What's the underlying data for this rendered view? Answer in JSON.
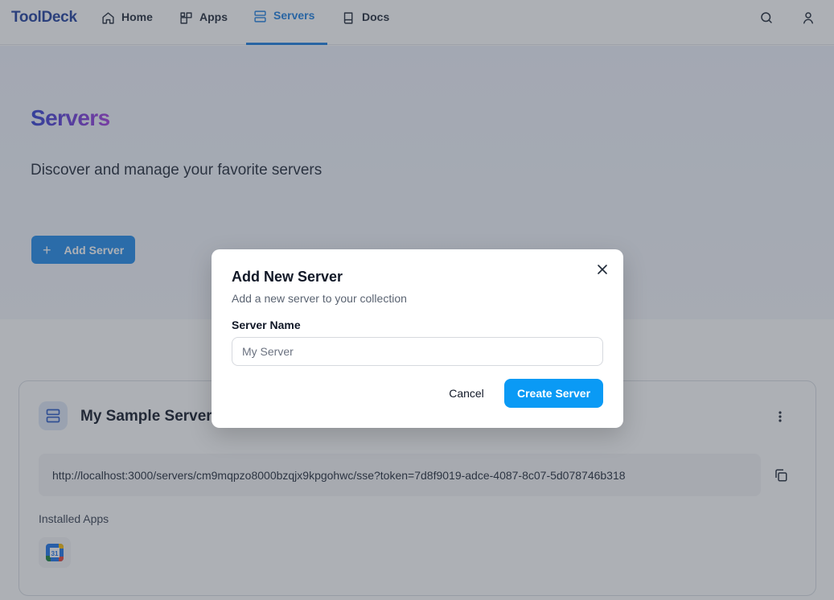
{
  "nav": {
    "logo": "ToolDeck",
    "items": [
      {
        "label": "Home",
        "icon": "home-icon"
      },
      {
        "label": "Apps",
        "icon": "apps-icon"
      },
      {
        "label": "Servers",
        "icon": "server-icon",
        "active": true
      },
      {
        "label": "Docs",
        "icon": "book-icon"
      }
    ],
    "right_icons": [
      "search-icon",
      "user-icon"
    ],
    "accent_color": "#1d7fe0"
  },
  "page": {
    "title": "Servers",
    "subtitle": "Discover and manage your favorite servers",
    "add_button_label": "Add Server"
  },
  "server_card": {
    "name": "My Sample Server",
    "url": "http://localhost:3000/servers/cm9mqpzo8000bzqjx9kpgohwc/sse?token=7d8f9019-adce-4087-8c07-5d078746b318",
    "installed_label": "Installed Apps",
    "installed_apps": [
      {
        "icon": "google-calendar-icon",
        "badge": "31"
      }
    ]
  },
  "dialog": {
    "title": "Add New Server",
    "description": "Add a new server to your collection",
    "field_label": "Server Name",
    "field_placeholder": "My Server",
    "field_value": "",
    "cancel_label": "Cancel",
    "submit_label": "Create Server",
    "submit_color": "#0a9af5"
  }
}
